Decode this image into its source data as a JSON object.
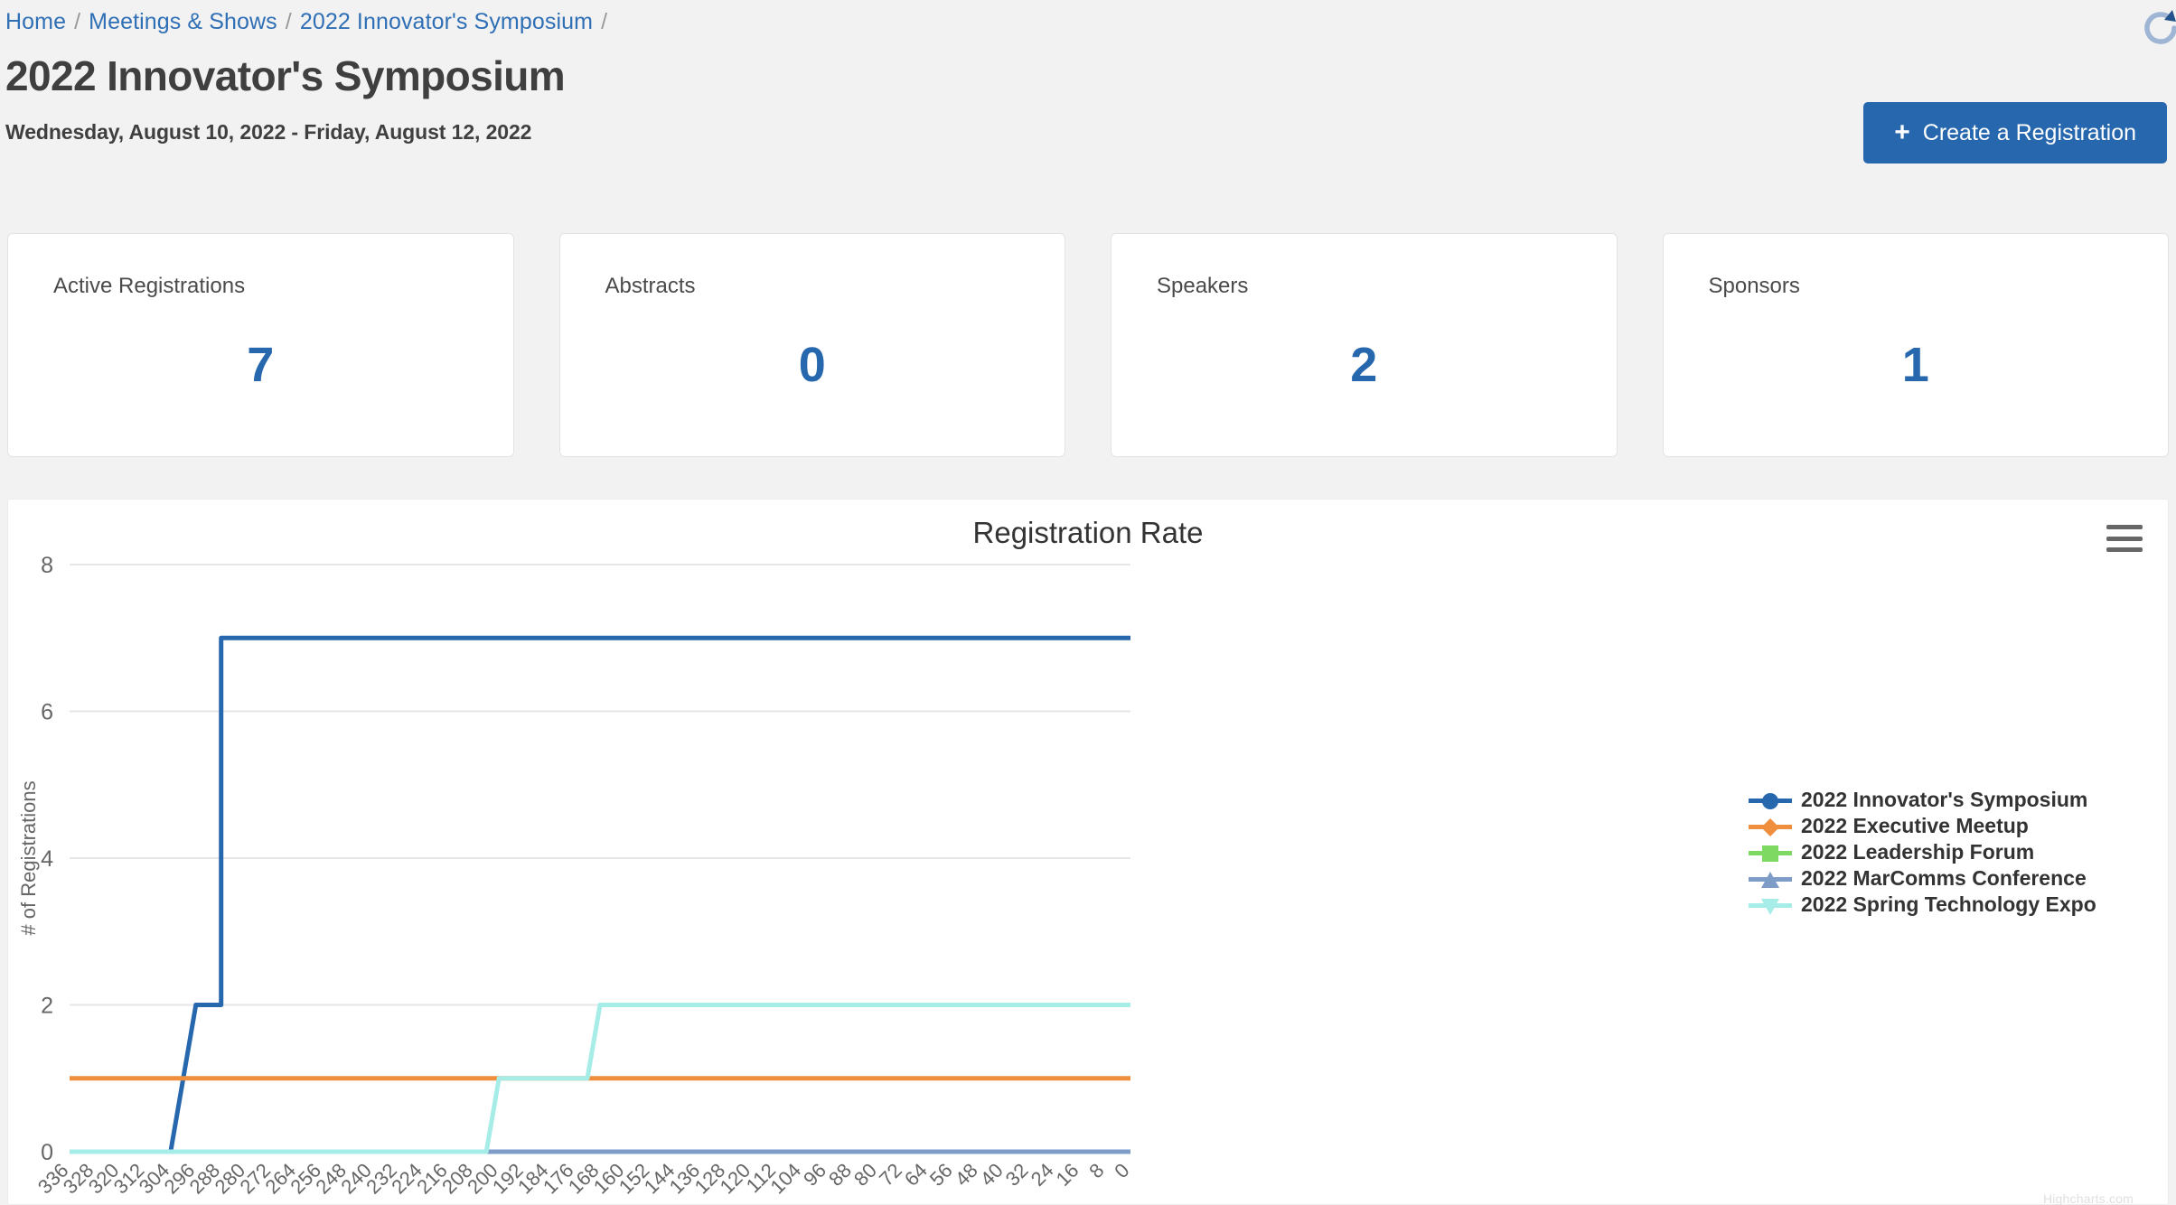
{
  "breadcrumb": {
    "items": [
      {
        "label": "Home"
      },
      {
        "label": "Meetings & Shows"
      },
      {
        "label": "2022 Innovator's Symposium"
      }
    ],
    "separator": "/"
  },
  "header": {
    "title": "2022 Innovator's Symposium",
    "subtitle": "Wednesday, August 10, 2022 - Friday, August 12, 2022",
    "reload_icon": "refresh-icon"
  },
  "actions": {
    "create_registration_label": "Create a Registration",
    "create_registration_icon": "plus-icon"
  },
  "stats": [
    {
      "label": "Active Registrations",
      "value": "7"
    },
    {
      "label": "Abstracts",
      "value": "0"
    },
    {
      "label": "Speakers",
      "value": "2"
    },
    {
      "label": "Sponsors",
      "value": "1"
    }
  ],
  "chart_panel": {
    "menu_icon": "hamburger-menu-icon",
    "credit": "Highcharts.com"
  },
  "colors": {
    "accent": "#2767ae",
    "breadcrumb_link": "#2f6fb5",
    "page_bg": "#f2f2f2",
    "card_bg": "#ffffff",
    "text_dark": "#3f3f3f"
  },
  "chart_data": {
    "type": "line",
    "title": "Registration Rate",
    "xlabel": "",
    "ylabel": "# of Registrations",
    "grid": true,
    "legend_position": "right",
    "step": "left",
    "xlim": [
      336,
      0
    ],
    "ylim": [
      0,
      8
    ],
    "yticks": [
      0,
      2,
      4,
      6,
      8
    ],
    "x_tick_labels": [
      336,
      328,
      320,
      312,
      304,
      296,
      288,
      280,
      272,
      264,
      256,
      248,
      240,
      232,
      224,
      216,
      208,
      200,
      192,
      184,
      176,
      168,
      160,
      152,
      144,
      136,
      128,
      120,
      112,
      104,
      96,
      88,
      80,
      72,
      64,
      56,
      48,
      40,
      32,
      24,
      16,
      8,
      0
    ],
    "x_axis_reversed": true,
    "series": [
      {
        "name": "2022 Innovator's Symposium",
        "color": "#2767ae",
        "marker": "circle",
        "points": [
          {
            "x": 336,
            "y": 0
          },
          {
            "x": 304,
            "y": 0
          },
          {
            "x": 300,
            "y": 1
          },
          {
            "x": 296,
            "y": 2
          },
          {
            "x": 288,
            "y": 2
          },
          {
            "x": 288,
            "y": 7
          },
          {
            "x": 0,
            "y": 7
          }
        ]
      },
      {
        "name": "2022 Executive Meetup",
        "color": "#ef8e3c",
        "marker": "diamond",
        "points": [
          {
            "x": 336,
            "y": 1
          },
          {
            "x": 0,
            "y": 1
          }
        ]
      },
      {
        "name": "2022 Leadership Forum",
        "color": "#7ed963",
        "marker": "square",
        "points": []
      },
      {
        "name": "2022 MarComms Conference",
        "color": "#7e9cc8",
        "marker": "triangle",
        "points": [
          {
            "x": 336,
            "y": 0
          },
          {
            "x": 0,
            "y": 0
          }
        ]
      },
      {
        "name": "2022 Spring Technology Expo",
        "color": "#a6ede8",
        "marker": "triangle-down",
        "points": [
          {
            "x": 336,
            "y": 0
          },
          {
            "x": 204,
            "y": 0
          },
          {
            "x": 200,
            "y": 1
          },
          {
            "x": 172,
            "y": 1
          },
          {
            "x": 168,
            "y": 2
          },
          {
            "x": 0,
            "y": 2
          }
        ]
      }
    ]
  }
}
